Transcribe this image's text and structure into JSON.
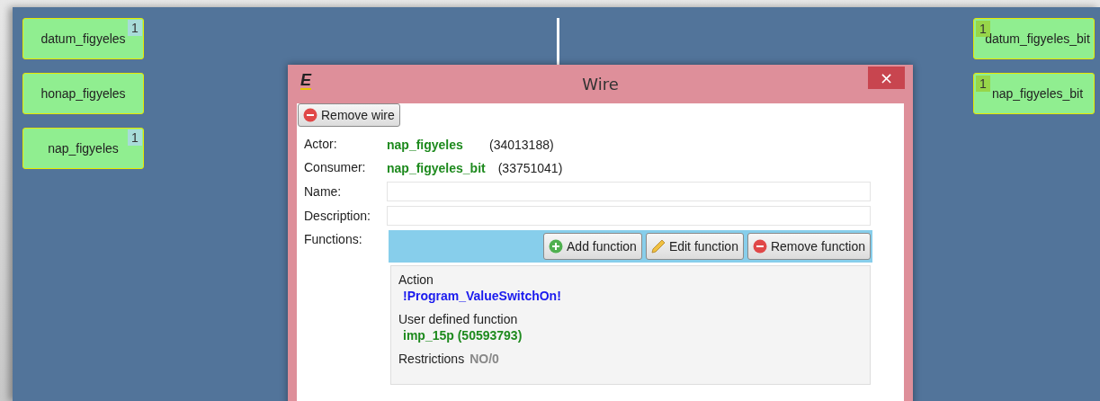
{
  "canvas": {
    "left_nodes": [
      {
        "label": "datum_figyeles",
        "badge": "1"
      },
      {
        "label": "honap_figyeles"
      },
      {
        "label": "nap_figyeles",
        "badge": "1"
      }
    ],
    "right_nodes": [
      {
        "label": "datum_figyeles_bit",
        "badge": "1"
      },
      {
        "label": "nap_figyeles_bit",
        "badge": "1"
      }
    ]
  },
  "dialog": {
    "logo": "E",
    "title": "Wire",
    "close": "×",
    "remove_wire_button": "Remove wire",
    "actor": {
      "label": "Actor:",
      "name": "nap_figyeles",
      "id": "(34013188)"
    },
    "consumer": {
      "label": "Consumer:",
      "name": "nap_figyeles_bit",
      "id": "(33751041)"
    },
    "name_label": "Name:",
    "description_label": "Description:",
    "functions_label": "Functions:",
    "function_buttons": [
      {
        "kind": "add",
        "label": "Add function"
      },
      {
        "kind": "edit",
        "label": "Edit function"
      },
      {
        "kind": "remove",
        "label": "Remove function"
      }
    ],
    "function": {
      "action_label": "Action",
      "action_value": "!Program_ValueSwitchOn!",
      "udf_label": "User defined function",
      "udf_value": "imp_15p (50593793)",
      "restrictions_label": "Restrictions",
      "restrictions_value": "NO/0"
    }
  }
}
